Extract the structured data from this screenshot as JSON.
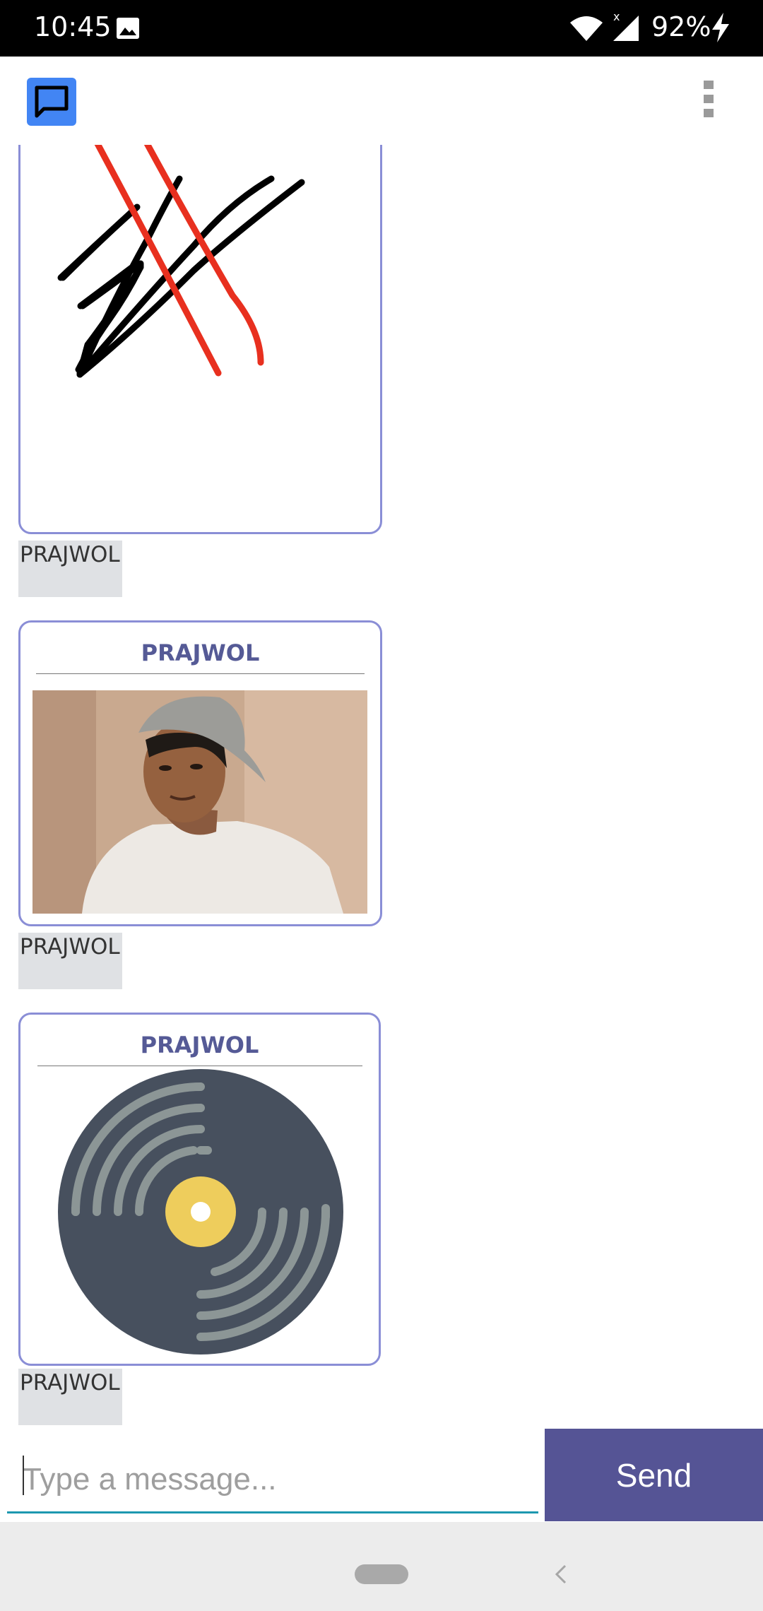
{
  "status_bar": {
    "time": "10:45",
    "battery": "92%",
    "icons": [
      "gallery-icon",
      "wifi-icon",
      "signal-icon",
      "charging-icon"
    ]
  },
  "app_bar": {
    "logo_icon": "chat-bubble-icon",
    "menu_icon": "overflow-menu-icon",
    "accent": "#4285f4"
  },
  "messages": [
    {
      "type": "drawing",
      "sender": "PRAJWOL"
    },
    {
      "type": "photo",
      "title": "PRAJWOL",
      "sender": "PRAJWOL"
    },
    {
      "type": "audio",
      "title": "PRAJWOL",
      "icon": "vinyl-record-icon",
      "sender": "PRAJWOL"
    }
  ],
  "composer": {
    "placeholder": "Type a message...",
    "value": "",
    "send_label": "Send",
    "send_color": "#555495"
  },
  "nav_bar": {
    "icons": [
      "home-pill-icon",
      "back-icon"
    ]
  }
}
